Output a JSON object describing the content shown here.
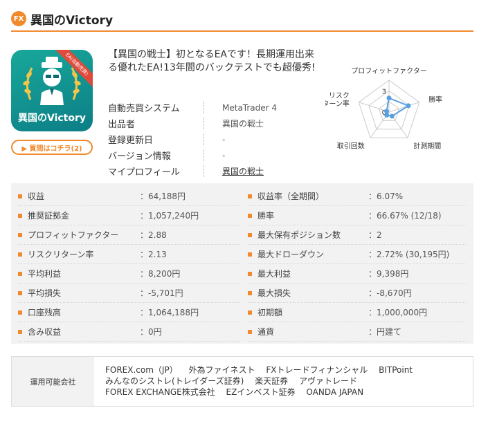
{
  "header": {
    "badge": "FX",
    "title": "異国のVictory"
  },
  "product": {
    "logo_text": "異国のVictory",
    "ribbon_text": "EA(自動売買)",
    "question_button": "▶ 質問はコチラ(2)",
    "headline": "【異国の戦士】初となるEAです！長期運用出来る優れたEA!13年間のバックテストでも超優秀!"
  },
  "info": [
    {
      "key": "自動売買システム",
      "value": "MetaTrader 4"
    },
    {
      "key": "出品者",
      "value": "異国の戦士"
    },
    {
      "key": "登録更新日",
      "value": "-"
    },
    {
      "key": "バージョン情報",
      "value": "-"
    },
    {
      "key": "マイプロフィール",
      "value": "異国の戦士"
    }
  ],
  "radar": {
    "labels": [
      "プロフィットファクター",
      "勝率",
      "計測期間",
      "取引回数",
      "リスク\nターン率"
    ],
    "scale_labels": [
      "3",
      "0"
    ],
    "levels": [
      2.2,
      3.2,
      0.8,
      0.6,
      0.4
    ],
    "max": 5,
    "grid_color": "#cccccc",
    "series_color": "#5aa0e0"
  },
  "stats_left": [
    {
      "label": "収益",
      "value": "：64,188円"
    },
    {
      "label": "推奨証拠金",
      "value": "：1,057,240円"
    },
    {
      "label": "プロフィットファクター",
      "value": "：2.88"
    },
    {
      "label": "リスクリターン率",
      "value": "：2.13"
    },
    {
      "label": "平均利益",
      "value": "：8,200円"
    },
    {
      "label": "平均損失",
      "value": "：-5,701円"
    },
    {
      "label": "口座残高",
      "value": "：1,064,188円"
    },
    {
      "label": "含み収益",
      "value": "：0円"
    }
  ],
  "stats_right": [
    {
      "label": "収益率（全期間）",
      "value": "：6.07%"
    },
    {
      "label": "勝率",
      "value": "：66.67% (12/18)"
    },
    {
      "label": "最大保有ポジション数",
      "value": "：2"
    },
    {
      "label": "最大ドローダウン",
      "value": "：2.72% (30,195円)"
    },
    {
      "label": "最大利益",
      "value": "：9,398円"
    },
    {
      "label": "最大損失",
      "value": "：-8,670円"
    },
    {
      "label": "初期額",
      "value": "：1,000,000円"
    },
    {
      "label": "通貨",
      "value": "：円建て"
    }
  ],
  "companies": {
    "label": "運用可能会社",
    "lines": [
      [
        "FOREX.com（JP）",
        "外為ファイネスト",
        "FXトレードフィナンシャル",
        "BITPoint"
      ],
      [
        "みんなのシストレ(トレイダーズ証券)",
        "楽天証券",
        "アヴァトレード"
      ],
      [
        "FOREX EXCHANGE株式会社",
        "EZインベスト証券",
        "OANDA JAPAN"
      ]
    ]
  },
  "colors": {
    "accent": "#f08a2c",
    "logo_bg": "#12988f"
  }
}
